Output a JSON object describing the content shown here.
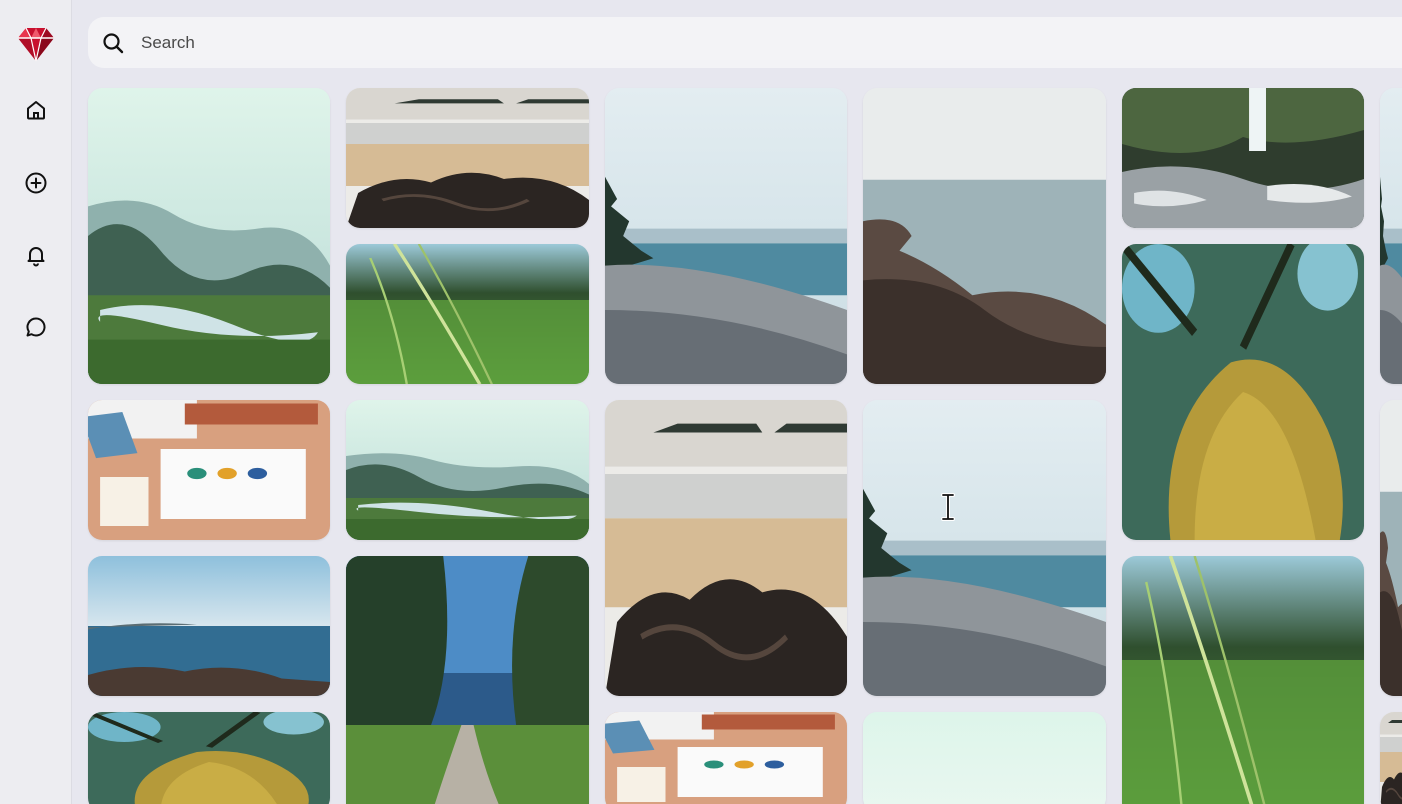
{
  "app": {
    "brand": "ruby-gem-logo",
    "accent": "#c8102e"
  },
  "sidebar": {
    "items": [
      {
        "id": "home",
        "icon": "home-icon"
      },
      {
        "id": "create",
        "icon": "plus-circle-icon"
      },
      {
        "id": "notifications",
        "icon": "bell-icon"
      },
      {
        "id": "messages",
        "icon": "chat-bubble-icon"
      }
    ]
  },
  "search": {
    "placeholder": "Search",
    "value": "",
    "icon": "search-icon"
  },
  "feed": {
    "pins": [
      {
        "id": "river-valley-mist",
        "scene": "valley"
      },
      {
        "id": "beach-rocks-shore",
        "scene": "beach"
      },
      {
        "id": "rocky-coast-trees",
        "scene": "coast"
      },
      {
        "id": "rocky-sea-cliff",
        "scene": "rocksea"
      },
      {
        "id": "mountain-waterfall",
        "scene": "waterfall"
      },
      {
        "id": "grass-closeup",
        "scene": "grass"
      },
      {
        "id": "mossy-rock-closeup",
        "scene": "moss"
      },
      {
        "id": "desk-flatlay",
        "scene": "desk"
      },
      {
        "id": "river-valley-small",
        "scene": "valley"
      },
      {
        "id": "beach-rocks-tall",
        "scene": "beach"
      },
      {
        "id": "coast-pebbles",
        "scene": "coast"
      },
      {
        "id": "blurred-grass-closeup",
        "scene": "grass"
      },
      {
        "id": "sea-horizon-rocks",
        "scene": "sea"
      },
      {
        "id": "forest-path",
        "scene": "path"
      },
      {
        "id": "mossy-rock-crop",
        "scene": "moss"
      },
      {
        "id": "desk-flatlay-crop",
        "scene": "desk"
      },
      {
        "id": "pale-sky",
        "scene": "mint"
      },
      {
        "id": "partial-column-top",
        "scene": "coast"
      },
      {
        "id": "partial-column-mid",
        "scene": "rocksea"
      },
      {
        "id": "partial-column-low",
        "scene": "beach"
      }
    ]
  }
}
